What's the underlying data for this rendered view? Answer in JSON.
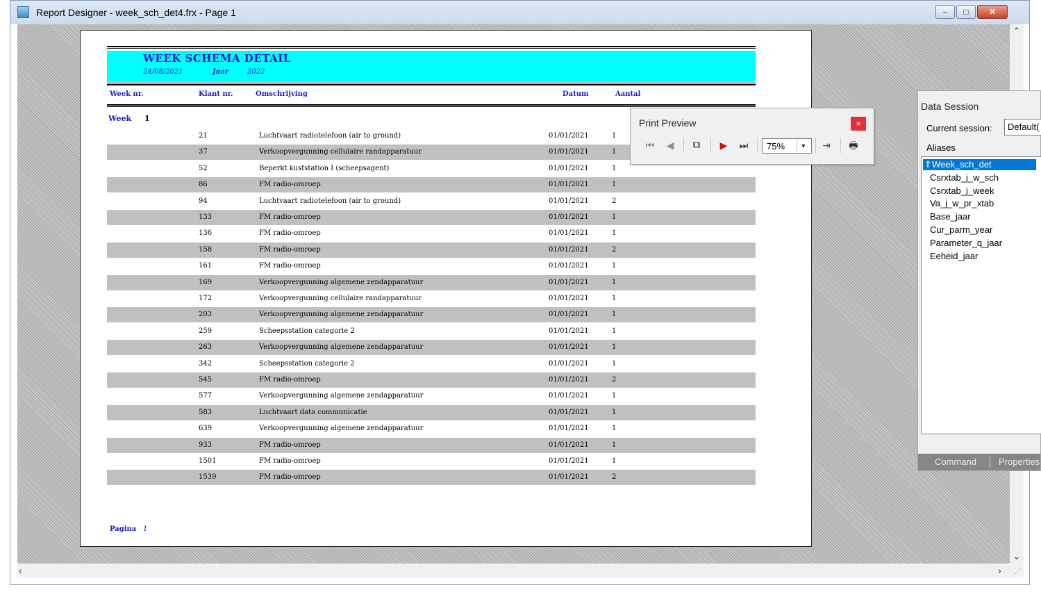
{
  "window": {
    "title": "Report Designer - week_sch_det4.frx - Page 1",
    "min_glyph": "–",
    "max_glyph": "□",
    "close_glyph": "✕"
  },
  "report": {
    "title": "WEEK SCHEMA DETAIL",
    "date": "24/08/2021",
    "jaar_label": "Jaar",
    "jaar_value": "2022",
    "columns": {
      "week": "Week nr.",
      "klant": "Klant nr.",
      "omschrijving": "Omschrijving",
      "datum": "Datum",
      "aantal": "Aantal"
    },
    "group_label": "Week",
    "group_value": "1",
    "rows": [
      {
        "klant": "21",
        "omschrijving": "Luchtvaart radiotelefoon (air to ground)",
        "datum": "01/01/2021",
        "aantal": "1"
      },
      {
        "klant": "37",
        "omschrijving": "Verkoopvergunning cellulaire randapparatuur",
        "datum": "01/01/2021",
        "aantal": "1"
      },
      {
        "klant": "52",
        "omschrijving": "Beperkt kuststation I (scheepsagent)",
        "datum": "01/01/2021",
        "aantal": "1"
      },
      {
        "klant": "86",
        "omschrijving": "FM radio-omroep",
        "datum": "01/01/2021",
        "aantal": "1"
      },
      {
        "klant": "94",
        "omschrijving": "Luchtvaart radiotelefoon (air to ground)",
        "datum": "01/01/2021",
        "aantal": "2"
      },
      {
        "klant": "133",
        "omschrijving": "FM radio-omroep",
        "datum": "01/01/2021",
        "aantal": "1"
      },
      {
        "klant": "136",
        "omschrijving": "FM radio-omroep",
        "datum": "01/01/2021",
        "aantal": "1"
      },
      {
        "klant": "158",
        "omschrijving": "FM radio-omroep",
        "datum": "01/01/2021",
        "aantal": "2"
      },
      {
        "klant": "161",
        "omschrijving": "FM radio-omroep",
        "datum": "01/01/2021",
        "aantal": "1"
      },
      {
        "klant": "169",
        "omschrijving": "Verkoopvergunning algemene zendapparatuur",
        "datum": "01/01/2021",
        "aantal": "1"
      },
      {
        "klant": "172",
        "omschrijving": "Verkoopvergunning cellulaire randapparatuur",
        "datum": "01/01/2021",
        "aantal": "1"
      },
      {
        "klant": "203",
        "omschrijving": "Verkoopvergunning algemene zendapparatuur",
        "datum": "01/01/2021",
        "aantal": "1"
      },
      {
        "klant": "259",
        "omschrijving": "Scheepsstation categorie 2",
        "datum": "01/01/2021",
        "aantal": "1"
      },
      {
        "klant": "263",
        "omschrijving": "Verkoopvergunning algemene zendapparatuur",
        "datum": "01/01/2021",
        "aantal": "1"
      },
      {
        "klant": "342",
        "omschrijving": "Scheepsstation categorie 2",
        "datum": "01/01/2021",
        "aantal": "1"
      },
      {
        "klant": "545",
        "omschrijving": "FM radio-omroep",
        "datum": "01/01/2021",
        "aantal": "2"
      },
      {
        "klant": "577",
        "omschrijving": "Verkoopvergunning algemene zendapparatuur",
        "datum": "01/01/2021",
        "aantal": "1"
      },
      {
        "klant": "583",
        "omschrijving": "Luchtvaart data communicatie",
        "datum": "01/01/2021",
        "aantal": "1"
      },
      {
        "klant": "639",
        "omschrijving": "Verkoopvergunning algemene zendapparatuur",
        "datum": "01/01/2021",
        "aantal": "1"
      },
      {
        "klant": "933",
        "omschrijving": "FM radio-omroep",
        "datum": "01/01/2021",
        "aantal": "1"
      },
      {
        "klant": "1501",
        "omschrijving": "FM radio-omroep",
        "datum": "01/01/2021",
        "aantal": "1"
      },
      {
        "klant": "1539",
        "omschrijving": "FM radio-omroep",
        "datum": "01/01/2021",
        "aantal": "2"
      }
    ],
    "footer_label": "Pagina",
    "footer_value": "1"
  },
  "print_preview": {
    "title": "Print Preview",
    "close_glyph": "×",
    "first_glyph": "⏮",
    "prev_glyph": "◀",
    "pages_glyph": "⧉",
    "next_glyph": "▶",
    "last_glyph": "⏭",
    "zoom_value": "75%",
    "zoom_arrow_glyph": "▼",
    "close_preview_glyph": "⇥",
    "print_glyph": "🖶"
  },
  "data_session": {
    "title": "Data Session",
    "current_session_label": "Current session:",
    "current_session_value": "Default(",
    "aliases_label": "Aliases",
    "aliases": [
      "Week_sch_det",
      "Csrxtab_j_w_sch",
      "Csrxtab_j_week",
      "Va_j_w_pr_xtab",
      "Base_jaar",
      "Cur_parm_year",
      "Parameter_q_jaar",
      "Eeheid_jaar"
    ],
    "selected_prefix": "⇑",
    "tab_command": "Command",
    "tab_properties": "Properties"
  },
  "scrollbars": {
    "up_glyph": "⌃",
    "down_glyph": "⌄",
    "left_glyph": "‹",
    "right_glyph": "›",
    "grip_glyph": "⋰"
  }
}
